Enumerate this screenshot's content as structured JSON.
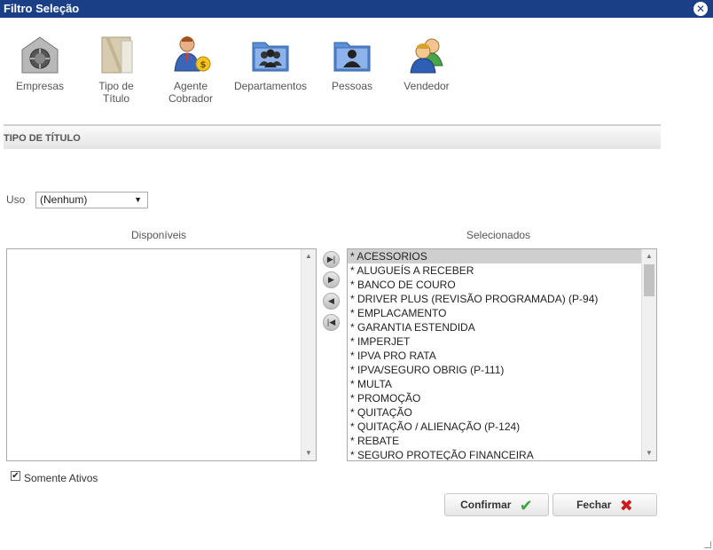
{
  "window": {
    "title": "Filtro Seleção",
    "close_icon": "close-icon"
  },
  "toolbar": {
    "items": [
      {
        "label": "Empresas",
        "icon": "safe-icon"
      },
      {
        "label": "Tipo de Título",
        "icon": "document-icon"
      },
      {
        "label": "Agente Cobrador",
        "icon": "agent-money-icon"
      },
      {
        "label": "Departamentos",
        "icon": "group-folder-icon"
      },
      {
        "label": "Pessoas",
        "icon": "person-folder-icon"
      },
      {
        "label": "Vendedor",
        "icon": "users-icon"
      }
    ]
  },
  "section": {
    "title": "TIPO DE TÍTULO"
  },
  "uso": {
    "label": "Uso",
    "value": "(Nenhum)"
  },
  "disponiveis": {
    "label": "Disponíveis",
    "items": []
  },
  "selecionados": {
    "label": "Selecionados",
    "items": [
      "* ACESSORIOS",
      "* ALUGUEÍS A RECEBER",
      "* BANCO DE COURO",
      "* DRIVER PLUS (REVISÃO PROGRAMADA) (P-94)",
      "* EMPLACAMENTO",
      "* GARANTIA ESTENDIDA",
      "* IMPERJET",
      "* IPVA PRO RATA",
      "* IPVA/SEGURO OBRIG (P-111)",
      "* MULTA",
      "* PROMOÇÃO",
      "* QUITAÇÃO",
      "* QUITAÇÃO / ALIENAÇÃO (P-124)",
      "* REBATE",
      "* SEGURO PROTEÇÃO FINANCEIRA"
    ],
    "selected_index": 0
  },
  "movers": {
    "all_right": "▶|",
    "right": "▶",
    "left": "◀",
    "all_left": "|◀"
  },
  "somente_ativos": {
    "label": "Somente Ativos",
    "checked": true
  },
  "buttons": {
    "confirm": "Confirmar",
    "close": "Fechar"
  }
}
